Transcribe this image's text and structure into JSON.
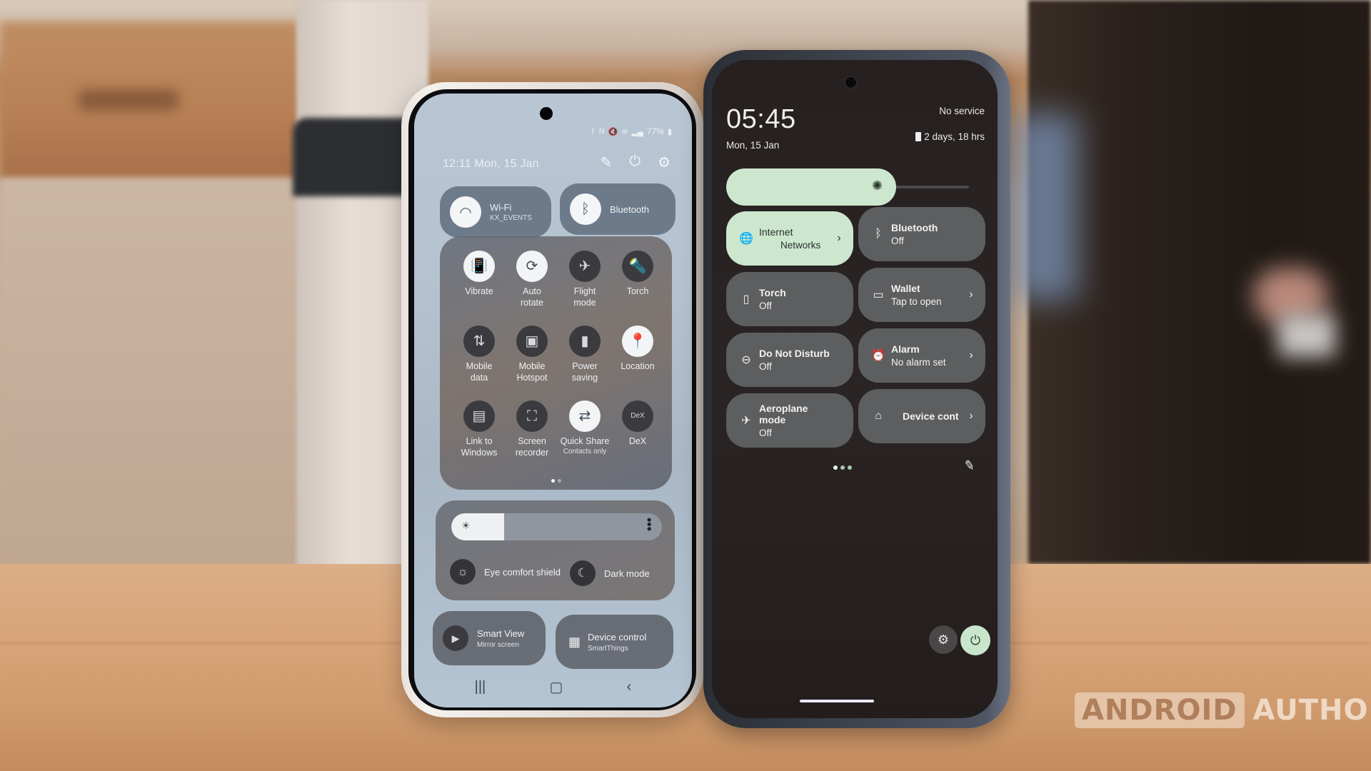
{
  "left_phone": {
    "status_bar": {
      "icons": [
        "bluetooth-icon",
        "nfc-icon",
        "mute-icon",
        "wifi-icon",
        "signal-icon"
      ],
      "battery": "77%"
    },
    "datetime": "12:11  Mon, 15 Jan",
    "header_icons": [
      "edit-icon",
      "power-icon",
      "settings-icon"
    ],
    "top_pills": [
      {
        "icon": "wifi-icon",
        "label": "Wi-Fi",
        "sublabel": "KX_EVENTS",
        "state": "on"
      },
      {
        "icon": "bluetooth-icon",
        "label": "Bluetooth",
        "state": "on"
      }
    ],
    "tiles": [
      {
        "icon": "vibrate-icon",
        "glyph": "📳",
        "label": "Vibrate",
        "state": "on"
      },
      {
        "icon": "auto-rotate-icon",
        "glyph": "⟳",
        "label": "Auto\nrotate",
        "state": "on"
      },
      {
        "icon": "airplane-icon",
        "glyph": "✈",
        "label": "Flight\nmode",
        "state": "off"
      },
      {
        "icon": "torch-icon",
        "glyph": "🔦",
        "label": "Torch",
        "state": "off"
      },
      {
        "icon": "mobile-data-icon",
        "glyph": "⇅",
        "label": "Mobile\ndata",
        "state": "off"
      },
      {
        "icon": "hotspot-icon",
        "glyph": "▣",
        "label": "Mobile\nHotspot",
        "state": "off"
      },
      {
        "icon": "power-saving-icon",
        "glyph": "▮",
        "label": "Power\nsaving",
        "state": "off"
      },
      {
        "icon": "location-icon",
        "glyph": "📍",
        "label": "Location",
        "state": "on"
      },
      {
        "icon": "link-to-windows-icon",
        "glyph": "▤",
        "label": "Link to\nWindows",
        "state": "off"
      },
      {
        "icon": "screen-recorder-icon",
        "glyph": "⛶",
        "label": "Screen\nrecorder",
        "state": "off"
      },
      {
        "icon": "quick-share-icon",
        "glyph": "⇄",
        "label": "Quick Share",
        "sublabel": "Contacts only",
        "state": "on"
      },
      {
        "icon": "dex-icon",
        "glyph": "DeX",
        "label": "DeX",
        "state": "off"
      }
    ],
    "page_indicator": {
      "current": 1,
      "total": 2
    },
    "brightness": {
      "level_fraction": 0.25
    },
    "toggles": [
      {
        "icon": "eye-comfort-icon",
        "glyph": "☼",
        "label": "Eye comfort shield"
      },
      {
        "icon": "dark-mode-icon",
        "glyph": "☾",
        "label": "Dark mode"
      }
    ],
    "bottom_pills": [
      {
        "icon": "smart-view-icon",
        "glyph": "▶",
        "label": "Smart View",
        "sublabel": "Mirror screen"
      },
      {
        "icon": "device-control-icon",
        "glyph": "▦",
        "label": "Device control",
        "sublabel": "SmartThings"
      }
    ],
    "nav": {
      "recents": "|||",
      "home": "▢",
      "back": "‹"
    }
  },
  "right_phone": {
    "time": "05:45",
    "date": "Mon, 15 Jan",
    "carrier": "No service",
    "battery_estimate": "2 days, 18 hrs",
    "brightness": {
      "level_fraction": 0.7
    },
    "tiles": [
      {
        "icon": "internet-icon",
        "glyph": "🌐",
        "label": "Internet",
        "sublabel": "Networks",
        "active": true,
        "chevron": true
      },
      {
        "icon": "bluetooth-icon",
        "glyph": "ᛒ",
        "label": "Bluetooth",
        "sublabel": "Off",
        "active": false,
        "chevron": false
      },
      {
        "icon": "torch-icon",
        "glyph": "▯",
        "label": "Torch",
        "sublabel": "Off",
        "active": false,
        "chevron": false
      },
      {
        "icon": "wallet-icon",
        "glyph": "▭",
        "label": "Wallet",
        "sublabel": "Tap to open",
        "active": false,
        "chevron": true
      },
      {
        "icon": "do-not-disturb-icon",
        "glyph": "⊖",
        "label": "Do Not Disturb",
        "sublabel": "Off",
        "active": false,
        "chevron": false
      },
      {
        "icon": "alarm-icon",
        "glyph": "⏰",
        "label": "Alarm",
        "sublabel": "No alarm set",
        "active": false,
        "chevron": true
      },
      {
        "icon": "airplane-icon",
        "glyph": "✈",
        "label": "Aeroplane mode",
        "sublabel": "Off",
        "active": false,
        "chevron": false
      },
      {
        "icon": "home-icon",
        "glyph": "⌂",
        "label": "Device cont",
        "active": false,
        "chevron": true
      }
    ],
    "page_indicator": {
      "current": 1,
      "total": 3
    },
    "buttons": {
      "edit": "edit-icon",
      "settings": "settings-icon",
      "power": "power-icon"
    },
    "colors": {
      "accent": "#cde7cf",
      "tile": "#5c5e5f",
      "background": "#262020"
    }
  },
  "watermark": {
    "boxed": "ANDROID",
    "plain": "AUTHORITY"
  }
}
